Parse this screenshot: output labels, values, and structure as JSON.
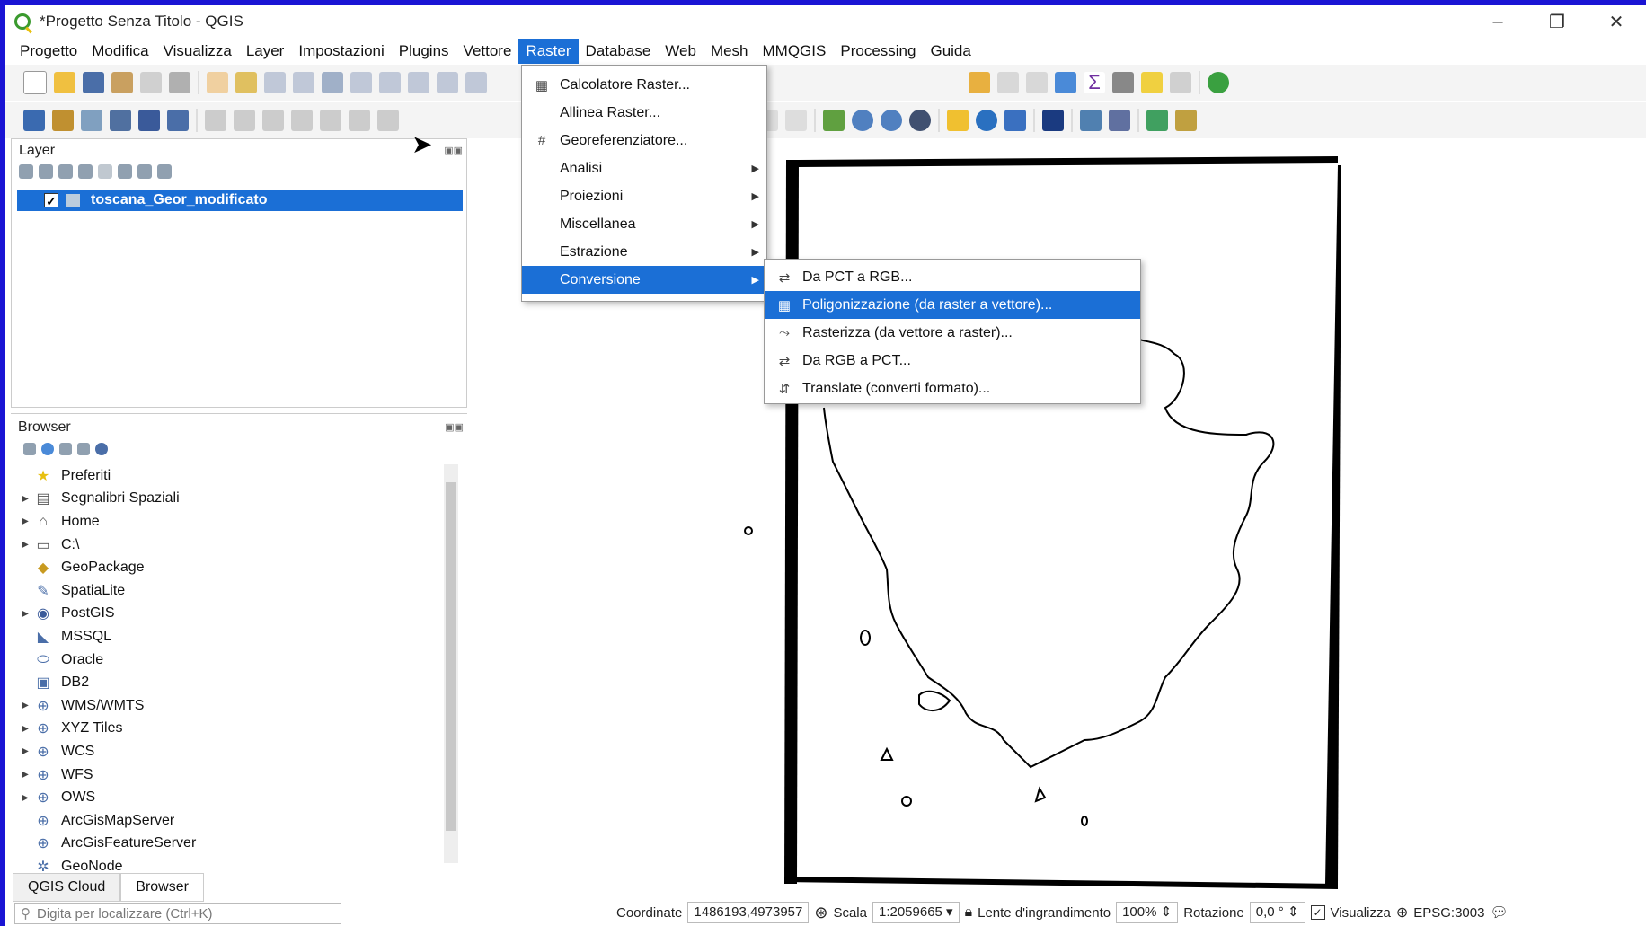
{
  "window": {
    "title": "*Progetto Senza Titolo - QGIS",
    "min": "–",
    "max": "❐",
    "close": "✕"
  },
  "menubar": [
    "Progetto",
    "Modifica",
    "Visualizza",
    "Layer",
    "Impostazioni",
    "Plugins",
    "Vettore",
    "Raster",
    "Database",
    "Web",
    "Mesh",
    "MMQGIS",
    "Processing",
    "Guida"
  ],
  "layers_panel": {
    "title": "Layer",
    "layer_name": "toscana_Geor_modificato",
    "checked": "✓"
  },
  "browser_panel": {
    "title": "Browser",
    "items": [
      {
        "label": "Preferiti",
        "icon": "star-icon",
        "glyph": "★",
        "color": "#e8c010",
        "expand": ""
      },
      {
        "label": "Segnalibri Spaziali",
        "icon": "bookmark-icon",
        "glyph": "▤",
        "color": "#555",
        "expand": "▶"
      },
      {
        "label": "Home",
        "icon": "home-folder-icon",
        "glyph": "⌂",
        "color": "#555",
        "expand": "▶"
      },
      {
        "label": "C:\\",
        "icon": "drive-icon",
        "glyph": "▭",
        "color": "#555",
        "expand": "▶"
      },
      {
        "label": "GeoPackage",
        "icon": "geopackage-icon",
        "glyph": "◆",
        "color": "#c89a20",
        "expand": ""
      },
      {
        "label": "SpatiaLite",
        "icon": "spatialite-icon",
        "glyph": "✎",
        "color": "#4a6ea8",
        "expand": ""
      },
      {
        "label": "PostGIS",
        "icon": "postgis-icon",
        "glyph": "◉",
        "color": "#3a5a9a",
        "expand": "▶"
      },
      {
        "label": "MSSQL",
        "icon": "mssql-icon",
        "glyph": "◣",
        "color": "#4a6ea8",
        "expand": ""
      },
      {
        "label": "Oracle",
        "icon": "oracle-icon",
        "glyph": "⬭",
        "color": "#4a6ea8",
        "expand": ""
      },
      {
        "label": "DB2",
        "icon": "db2-icon",
        "glyph": "▣",
        "color": "#4a6ea8",
        "expand": ""
      },
      {
        "label": "WMS/WMTS",
        "icon": "globe-icon",
        "glyph": "⊕",
        "color": "#4a6ea8",
        "expand": "▶"
      },
      {
        "label": "XYZ Tiles",
        "icon": "globe-icon",
        "glyph": "⊕",
        "color": "#4a6ea8",
        "expand": "▶"
      },
      {
        "label": "WCS",
        "icon": "globe-icon",
        "glyph": "⊕",
        "color": "#4a6ea8",
        "expand": "▶"
      },
      {
        "label": "WFS",
        "icon": "globe-icon",
        "glyph": "⊕",
        "color": "#4a6ea8",
        "expand": "▶"
      },
      {
        "label": "OWS",
        "icon": "globe-icon",
        "glyph": "⊕",
        "color": "#4a6ea8",
        "expand": "▶"
      },
      {
        "label": "ArcGisMapServer",
        "icon": "globe-icon",
        "glyph": "⊕",
        "color": "#4a6ea8",
        "expand": ""
      },
      {
        "label": "ArcGisFeatureServer",
        "icon": "globe-icon",
        "glyph": "⊕",
        "color": "#4a6ea8",
        "expand": ""
      },
      {
        "label": "GeoNode",
        "icon": "geonode-icon",
        "glyph": "✲",
        "color": "#4a6ea8",
        "expand": ""
      }
    ]
  },
  "tabs": [
    "QGIS Cloud",
    "Browser"
  ],
  "locator_placeholder": "Digita per localizzare (Ctrl+K)",
  "raster_menu": [
    {
      "label": "Calcolatore Raster...",
      "icon": "raster-calculator-icon",
      "glyph": "▦",
      "sub": ""
    },
    {
      "label": "Allinea Raster...",
      "icon": "",
      "glyph": "",
      "sub": ""
    },
    {
      "label": "Georeferenziatore...",
      "icon": "georeferencer-icon",
      "glyph": "#",
      "sub": ""
    },
    {
      "label": "Analisi",
      "icon": "",
      "glyph": "",
      "sub": "▶"
    },
    {
      "label": "Proiezioni",
      "icon": "",
      "glyph": "",
      "sub": "▶"
    },
    {
      "label": "Miscellanea",
      "icon": "",
      "glyph": "",
      "sub": "▶"
    },
    {
      "label": "Estrazione",
      "icon": "",
      "glyph": "",
      "sub": "▶"
    },
    {
      "label": "Conversione",
      "icon": "",
      "glyph": "",
      "sub": "▶"
    }
  ],
  "conversion_menu": [
    {
      "label": "Da PCT a RGB...",
      "icon": "pct-to-rgb-icon",
      "glyph": "⇄"
    },
    {
      "label": "Poligonizzazione (da raster a vettore)...",
      "icon": "polygonize-icon",
      "glyph": "▦"
    },
    {
      "label": "Rasterizza (da vettore a raster)...",
      "icon": "rasterize-icon",
      "glyph": "⤳"
    },
    {
      "label": "Da RGB a PCT...",
      "icon": "rgb-to-pct-icon",
      "glyph": "⇄"
    },
    {
      "label": "Translate (converti formato)...",
      "icon": "translate-icon",
      "glyph": "⇵"
    }
  ],
  "statusbar": {
    "coord_label": "Coordinate",
    "coord_value": "1486193,4973957",
    "scale_label": "Scala",
    "scale_value": "1:2059665",
    "magnifier_label": "Lente d'ingrandimento",
    "magnifier_value": "100%",
    "rotation_label": "Rotazione",
    "rotation_value": "0,0 °",
    "render_label": "Visualizza",
    "crs": "EPSG:3003"
  },
  "colors": {
    "accent": "#1b6fd6",
    "frame": "#1a14d4"
  }
}
